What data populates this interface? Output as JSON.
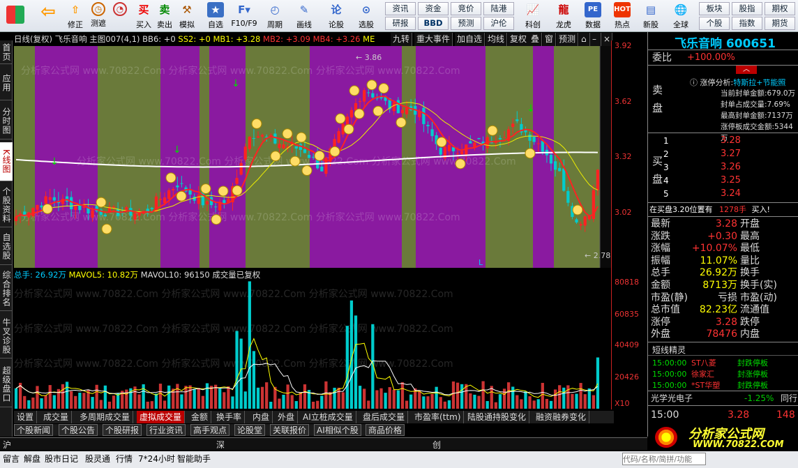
{
  "toolbar": {
    "buttons": [
      {
        "label": "",
        "icon": "windows-icon"
      },
      {
        "label": "",
        "icon": "back-arrow-icon"
      },
      {
        "label": "修正",
        "icon": "up-arrow-icon"
      },
      {
        "label": "测遮",
        "icon": "clock-icon"
      },
      {
        "label": "买入",
        "icon": "buy-icon"
      },
      {
        "label": "卖出",
        "icon": "sell-icon"
      },
      {
        "label": "模拟",
        "icon": "hammer-icon"
      },
      {
        "label": "自选",
        "icon": "star-icon"
      },
      {
        "label": "F10/F9",
        "icon": "f10-icon"
      },
      {
        "label": "周期",
        "icon": "period-icon"
      },
      {
        "label": "画线",
        "icon": "pencil-icon"
      },
      {
        "label": "论股",
        "icon": "discuss-icon"
      },
      {
        "label": "选股",
        "icon": "select-stock-icon"
      }
    ],
    "grid": [
      [
        "资讯",
        "资金",
        "竞价",
        "陆港"
      ],
      [
        "研报",
        "BBD",
        "预测",
        "沪伦"
      ]
    ],
    "buttons2": [
      {
        "label": "科创",
        "icon": "kechuang-icon"
      },
      {
        "label": "龙虎",
        "icon": "dragon-icon"
      },
      {
        "label": "数据",
        "icon": "pe-icon"
      },
      {
        "label": "热点",
        "icon": "hot-icon"
      },
      {
        "label": "新股",
        "icon": "newstock-icon"
      },
      {
        "label": "全球",
        "icon": "globe-icon"
      }
    ],
    "grid2": [
      [
        "板块",
        "股指",
        "期权"
      ],
      [
        "个股",
        "指数",
        "期货"
      ]
    ]
  },
  "leftnav": [
    "首页",
    "应用",
    "分时图",
    "K线图",
    "个股资料",
    "自选股",
    "综合排名",
    "牛叉诊股",
    "超级盘口"
  ],
  "chart": {
    "header": {
      "name": "日线(复权)",
      "stock": "飞乐音响",
      "template": "主图007(4,1)",
      "bb6": "BB6: +0",
      "ss2": "SS2: +0",
      "mb1": "MB1: +3.28",
      "mb2": "MB2: +3.09",
      "mb4": "MB4: +3.26",
      "me": "ME"
    },
    "menu": [
      "九转",
      "重大事件",
      "加自选",
      "均线",
      "复权",
      "叠",
      "窗",
      "预测"
    ],
    "y_labels": [
      "3.92",
      "3.62",
      "3.32",
      "3.02"
    ],
    "high_label": "3.86",
    "low_label": "2.78",
    "marker_l": "L"
  },
  "volume": {
    "header": {
      "total": "总手: 26.92万",
      "mavol5": "MAVOL5: 10.82万",
      "mavol10": "MAVOL10: 96150",
      "note": "成交量已复权"
    },
    "y_labels": [
      "80818",
      "60835",
      "40409",
      "20426"
    ],
    "unit": "X10"
  },
  "watermark": "分析家公式网 www.70822.Com 分析家公式网 www.70822.Com 分析家公式网 www.70822.Com",
  "bottomtabs": [
    "设置",
    "成交量",
    "多周期成交量",
    "虚拟成交量",
    "金额",
    "换手率",
    "内盘",
    "外盘",
    "AI立桩成交量",
    "盘后成交量",
    "市盈率(ttm)",
    "陆股通持股变化",
    "融资融券变化"
  ],
  "tabs2": [
    "个股新闻",
    "个股公告",
    "个股研报",
    "行业资讯",
    "高手观点",
    "论股堂",
    "关联报价",
    "AI相似个股",
    "商品价格"
  ],
  "statusbar": {
    "sh": "沪",
    "sz": "深",
    "cy": "创"
  },
  "right": {
    "title": "飞乐音响",
    "code": "600651",
    "weibi_label": "委比",
    "weibi": "+100.00%",
    "limit_title": "涨停分析:",
    "limit_theme": "特斯拉+节能照",
    "limit_lines": [
      "当前封单金额:679.0万",
      "封单占成交量:7.69%",
      "最高封单金额:7137万",
      "涨停板成交金额:5344万"
    ],
    "sell_label": "卖盘",
    "buy_label": "买盘",
    "buy": [
      {
        "n": "1",
        "p": "3.28"
      },
      {
        "n": "2",
        "p": "3.27"
      },
      {
        "n": "3",
        "p": "3.26"
      },
      {
        "n": "4",
        "p": "3.25"
      },
      {
        "n": "5",
        "p": "3.24"
      }
    ],
    "buy_note": "在买盘3.20位置有",
    "buy_note_qty": "1278手",
    "buy_note_action": "买入!",
    "stats": [
      {
        "l": "最新",
        "v": "3.28",
        "r": "开盘",
        "rv": ""
      },
      {
        "l": "涨跌",
        "v": "+0.30",
        "r": "最高",
        "rv": ""
      },
      {
        "l": "涨幅",
        "v": "+10.07%",
        "r": "最低",
        "rv": ""
      },
      {
        "l": "振幅",
        "v": "11.07%",
        "r": "量比",
        "rv": ""
      },
      {
        "l": "总手",
        "v": "26.92万",
        "r": "换手",
        "rv": ""
      },
      {
        "l": "金额",
        "v": "8713万",
        "r": "换手(实)",
        "rv": ""
      },
      {
        "l": "市盈(静)",
        "v": "亏损",
        "r": "市盈(动)",
        "rv": ""
      },
      {
        "l": "总市值",
        "v": "82.23亿",
        "r": "流通值",
        "rv": ""
      },
      {
        "l": "涨停",
        "v": "3.28",
        "r": "跌停",
        "rv": ""
      },
      {
        "l": "外盘",
        "v": "78476",
        "r": "内盘",
        "rv": ""
      }
    ],
    "short_title": "短线精灵",
    "short": [
      {
        "t": "15:00:00",
        "n": "ST八菱",
        "e": "封跌停板"
      },
      {
        "t": "15:00:00",
        "n": "徐家汇",
        "e": "封涨停板"
      },
      {
        "t": "15:00:00",
        "n": "*ST华塑",
        "e": "封跌停板"
      }
    ],
    "sector": "光学光电子",
    "sector_chg": "-1.25%",
    "sector_more": "同行",
    "tick_time": "15:00",
    "tick_price": "3.28",
    "tick_vol": "148"
  },
  "footer": {
    "items": [
      "留言",
      "解盘",
      "股市日记",
      "股灵通",
      "行情",
      "7*24小时",
      "智能助手"
    ],
    "search": "代码/名称/简拼/功能",
    "logo": "分析家公式网",
    "logo_url": "WWW.70822.COM"
  },
  "chart_data": {
    "type": "candlestick",
    "y_range": [
      2.78,
      3.92
    ],
    "high": 3.86,
    "low": 2.78,
    "last_close": 3.28,
    "volume_range": [
      0,
      80818
    ]
  }
}
